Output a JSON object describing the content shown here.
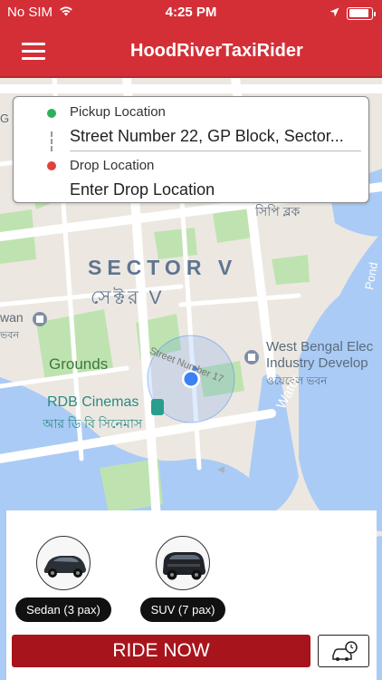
{
  "status_bar": {
    "carrier": "No SIM",
    "time": "4:25 PM",
    "battery_level": 0.9,
    "icons": [
      "wifi-icon",
      "location-arrow-icon",
      "battery-icon"
    ]
  },
  "nav": {
    "title": "HoodRiverTaxiRider",
    "menu_icon": "hamburger-menu-icon"
  },
  "location_card": {
    "pickup_label": "Pickup Location",
    "pickup_value": "Street Number 22, GP Block, Sector...",
    "drop_label": "Drop Location",
    "drop_placeholder": "Enter Drop Location"
  },
  "map": {
    "labels": {
      "sector": "SECTOR V",
      "sector_bn": "সেক্টর V",
      "grounds": "Grounds",
      "rdb": "RDB Cinemas",
      "rdb_bn": "আর ডি বি সিনেমাস",
      "wb_line1": "West Bengal Elec",
      "wb_line2": "Industry Develop",
      "wb_bn": "ওয়েবেল ভবন",
      "street17": "Street Number 17",
      "water": "Water",
      "pond": "Pond",
      "wan": "wan",
      "wan_bn": "ভবন",
      "g": "G",
      "sipbk": "সিপি ব্লক"
    }
  },
  "vehicles": [
    {
      "label": "Sedan (3 pax)",
      "icon": "sedan-car-icon"
    },
    {
      "label": "SUV (7 pax)",
      "icon": "suv-car-icon"
    }
  ],
  "actions": {
    "ride_now": "RIDE NOW",
    "schedule_icon": "schedule-ride-icon"
  },
  "colors": {
    "brand_red": "#d42f37",
    "button_red": "#a8141b",
    "pickup_green": "#2bb15a",
    "drop_red": "#e0413d",
    "current_location_blue": "#3b82f6"
  }
}
